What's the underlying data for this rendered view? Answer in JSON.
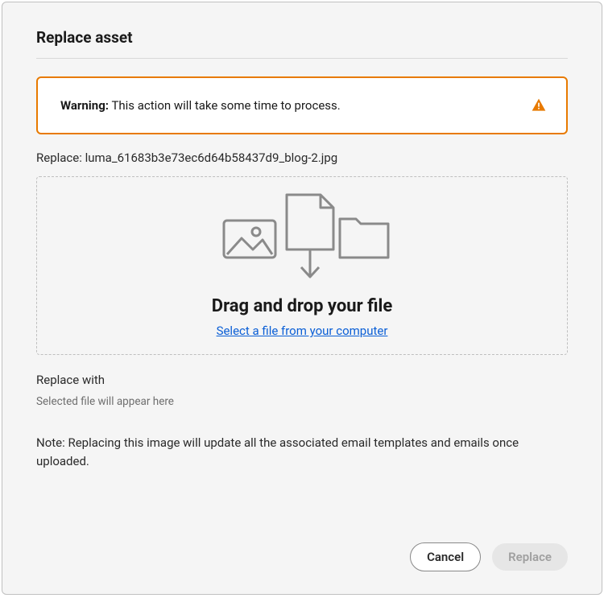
{
  "dialog": {
    "title": "Replace asset",
    "warning_prefix": "Warning:",
    "warning_message": "This action will take some time to process.",
    "replace_label": "Replace:",
    "replace_filename": "luma_61683b3e73ec6d64b58437d9_blog-2.jpg",
    "dropzone_title": "Drag and drop your file",
    "dropzone_link": "Select a file from your computer",
    "replace_with_label": "Replace with",
    "selected_file_placeholder": "Selected file will appear here",
    "note": "Note: Replacing this image will update all the associated email templates and emails once uploaded.",
    "cancel_label": "Cancel",
    "replace_button_label": "Replace"
  },
  "colors": {
    "warning_border": "#e87a00",
    "link": "#0b5fd6"
  }
}
